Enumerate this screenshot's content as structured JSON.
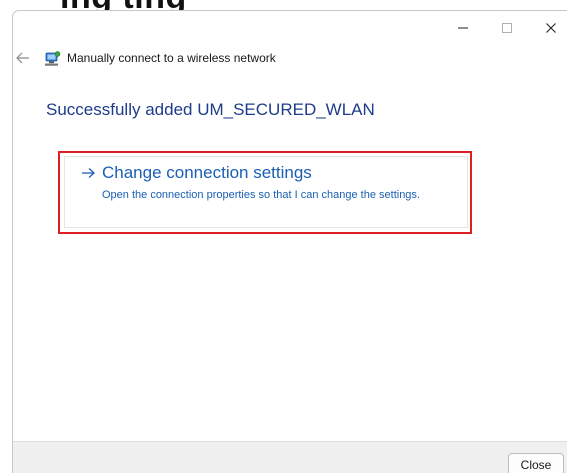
{
  "background": {
    "cropped_heading_text": "ing                    ting"
  },
  "window": {
    "controls": {
      "minimize_icon": "minimize-icon",
      "maximize_icon": "maximize-icon",
      "close_icon": "close-icon"
    },
    "nav": {
      "back_icon": "back-arrow-icon",
      "wizard_icon": "wireless-network-icon",
      "title": "Manually connect to a wireless network"
    },
    "heading": "Successfully added UM_SECURED_WLAN",
    "command_link": {
      "icon": "right-arrow-icon",
      "title": "Change connection settings",
      "description": "Open the connection properties so that I can change the settings.",
      "highlight_color": "#e02020"
    },
    "footer": {
      "close_label": "Close"
    }
  },
  "colors": {
    "heading": "#1e3c8a",
    "link": "#1a5fb4",
    "footer_bg": "#f0f0f0"
  }
}
